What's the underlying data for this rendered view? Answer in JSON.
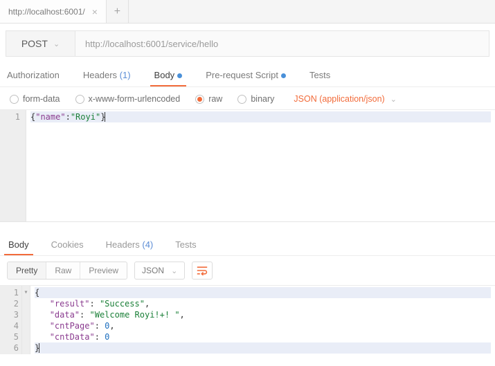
{
  "tabbar": {
    "tab_title": "http://localhost:6001/"
  },
  "request": {
    "method": "POST",
    "url": "http://localhost:6001/service/hello",
    "tabs": {
      "authorization": "Authorization",
      "headers": "Headers",
      "headers_count": "(1)",
      "body": "Body",
      "prerequest": "Pre-request Script",
      "tests": "Tests"
    },
    "body_type": {
      "form_data": "form-data",
      "x_www": "x-www-form-urlencoded",
      "raw": "raw",
      "binary": "binary",
      "content_type": "JSON (application/json)"
    },
    "body_raw": {
      "line1_key": "\"name\"",
      "line1_val": "\"Royi\""
    }
  },
  "response": {
    "tabs": {
      "body": "Body",
      "cookies": "Cookies",
      "headers": "Headers",
      "headers_count": "(4)",
      "tests": "Tests"
    },
    "view": {
      "pretty": "Pretty",
      "raw": "Raw",
      "preview": "Preview",
      "lang": "JSON"
    },
    "json": {
      "k_result": "\"result\"",
      "v_result": "\"Success\"",
      "k_data": "\"data\"",
      "v_data": "\"Welcome Royi!+! \"",
      "k_cntPage": "\"cntPage\"",
      "v_cntPage": "0",
      "k_cntData": "\"cntData\"",
      "v_cntData": "0"
    }
  }
}
